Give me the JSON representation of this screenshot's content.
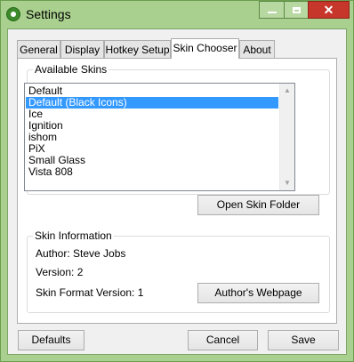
{
  "window": {
    "title": "Settings",
    "icon": "settings-app-icon",
    "close_glyph": "✕"
  },
  "tabs": [
    {
      "label": "General"
    },
    {
      "label": "Display"
    },
    {
      "label": "Hotkey Setup"
    },
    {
      "label": "Skin Chooser",
      "active": true
    },
    {
      "label": "About"
    }
  ],
  "available_skins": {
    "legend": "Available Skins",
    "items": [
      "Default",
      "Default (Black Icons)",
      "Ice",
      "Ignition",
      "ishom",
      "PiX",
      "Small Glass",
      "Vista 808"
    ],
    "selected_index": 1,
    "open_folder_label": "Open Skin Folder"
  },
  "skin_info": {
    "legend": "Skin Information",
    "author": "Author: Steve Jobs",
    "version": "Version: 2",
    "format_version": "Skin Format Version: 1",
    "webpage_label": "Author's Webpage"
  },
  "footer": {
    "defaults_label": "Defaults",
    "cancel_label": "Cancel",
    "save_label": "Save"
  },
  "colors": {
    "title_bar": "#a9d08e",
    "close_button": "#c7362b",
    "selection": "#3399ff"
  }
}
